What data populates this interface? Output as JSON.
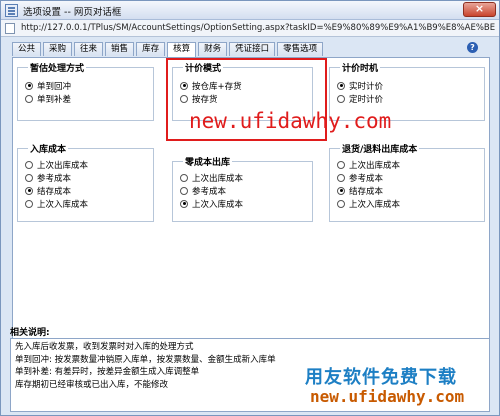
{
  "window": {
    "title": "选项设置 -- 网页对话框",
    "close_label": "×"
  },
  "address": {
    "url": "http://127.0.0.1/TPlus/SM/AccountSettings/OptionSetting.aspx?taskID=%E9%80%89%E9%A1%B9%E8%AE%BE%I"
  },
  "tabs": [
    "公共",
    "采购",
    "往来",
    "销售",
    "库存",
    "核算",
    "财务",
    "凭证接口",
    "零售选项"
  ],
  "active_tab_index": 5,
  "groups": {
    "estimate": {
      "legend": "暂估处理方式",
      "options": [
        {
          "label": "单到回冲",
          "selected": true
        },
        {
          "label": "单到补差",
          "selected": false
        }
      ]
    },
    "pricing_mode": {
      "legend": "计价模式",
      "options": [
        {
          "label": "按仓库+存货",
          "selected": true
        },
        {
          "label": "按存货",
          "selected": false
        }
      ]
    },
    "pricing_time": {
      "legend": "计价时机",
      "options": [
        {
          "label": "实时计价",
          "selected": true
        },
        {
          "label": "定时计价",
          "selected": false
        }
      ]
    },
    "inbound_cost": {
      "legend": "入库成本",
      "options": [
        {
          "label": "上次出库成本",
          "selected": false
        },
        {
          "label": "参考成本",
          "selected": false
        },
        {
          "label": "结存成本",
          "selected": true
        },
        {
          "label": "上次入库成本",
          "selected": false
        }
      ]
    },
    "zero_outbound": {
      "legend": "零成本出库",
      "options": [
        {
          "label": "上次出库成本",
          "selected": false
        },
        {
          "label": "参考成本",
          "selected": false
        },
        {
          "label": "上次入库成本",
          "selected": true
        }
      ]
    },
    "return_cost": {
      "legend": "退货/退料出库成本",
      "options": [
        {
          "label": "上次出库成本",
          "selected": false
        },
        {
          "label": "参考成本",
          "selected": false
        },
        {
          "label": "结存成本",
          "selected": true
        },
        {
          "label": "上次入库成本",
          "selected": false
        }
      ]
    }
  },
  "explanation": {
    "title": "相关说明:",
    "lines": [
      "先入库后收发票，收到发票时对入库的处理方式",
      "单到回冲: 按发票数量冲销原入库单，按发票数量、金额生成新入库单",
      "单到补差: 有差异时，按差异金额生成入库调整单",
      "库存期初已经审核或已出入库，不能修改"
    ]
  },
  "watermark": {
    "url_red": "new.ufidawhy.com",
    "brand_cn": "用友软件免费下载",
    "brand_url": "new.ufidawhy.com"
  },
  "colors": {
    "highlight": "#e01c1c",
    "brand_blue": "#1d7fc4",
    "brand_orange": "#c85a00"
  }
}
